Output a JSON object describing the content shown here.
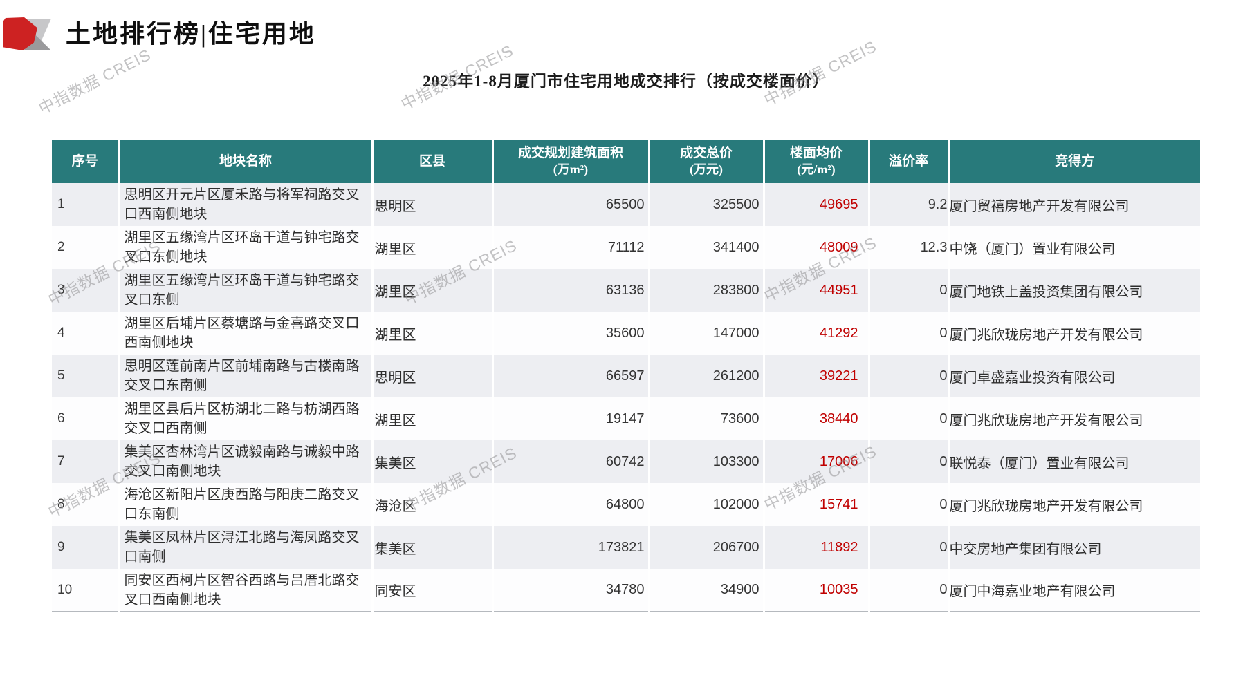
{
  "page": {
    "title": "土地排行榜|住宅用地",
    "subtitle": "2025年1-8月厦门市住宅用地成交排行（按成交楼面价）",
    "watermark": "中指数据 CREIS"
  },
  "colors": {
    "header_bg": "#287a7b",
    "accent_red": "#c00000",
    "row_alt_bg": "#edeef2",
    "logo_red": "#cd2222"
  },
  "table": {
    "columns": [
      {
        "label": "序号",
        "unit": ""
      },
      {
        "label": "地块名称",
        "unit": ""
      },
      {
        "label": "区县",
        "unit": ""
      },
      {
        "label": "成交规划建筑面积",
        "unit": "(万m²)"
      },
      {
        "label": "成交总价",
        "unit": "(万元)"
      },
      {
        "label": "楼面均价",
        "unit": "(元/m²)"
      },
      {
        "label": "溢价率",
        "unit": ""
      },
      {
        "label": "竞得方",
        "unit": ""
      }
    ],
    "rows": [
      {
        "seq": "1",
        "name": "思明区开元片区厦禾路与将军祠路交叉口西南侧地块",
        "district": "思明区",
        "area": "65500",
        "total_price": "325500",
        "floor_price": "49695",
        "premium": "9.2",
        "winner": "厦门贸禧房地产开发有限公司"
      },
      {
        "seq": "2",
        "name": "湖里区五缘湾片区环岛干道与钟宅路交叉口东侧地块",
        "district": "湖里区",
        "area": "71112",
        "total_price": "341400",
        "floor_price": "48009",
        "premium": "12.3",
        "winner": "中饶（厦门）置业有限公司"
      },
      {
        "seq": "3",
        "name": "湖里区五缘湾片区环岛干道与钟宅路交叉口东侧",
        "district": "湖里区",
        "area": "63136",
        "total_price": "283800",
        "floor_price": "44951",
        "premium": "0",
        "winner": "厦门地铁上盖投资集团有限公司"
      },
      {
        "seq": "4",
        "name": "湖里区后埔片区蔡塘路与金喜路交叉口西南侧地块",
        "district": "湖里区",
        "area": "35600",
        "total_price": "147000",
        "floor_price": "41292",
        "premium": "0",
        "winner": "厦门兆欣珑房地产开发有限公司"
      },
      {
        "seq": "5",
        "name": "思明区莲前南片区前埔南路与古楼南路交叉口东南侧",
        "district": "思明区",
        "area": "66597",
        "total_price": "261200",
        "floor_price": "39221",
        "premium": "0",
        "winner": "厦门卓盛嘉业投资有限公司"
      },
      {
        "seq": "6",
        "name": "湖里区县后片区枋湖北二路与枋湖西路交叉口西南侧",
        "district": "湖里区",
        "area": "19147",
        "total_price": "73600",
        "floor_price": "38440",
        "premium": "0",
        "winner": "厦门兆欣珑房地产开发有限公司"
      },
      {
        "seq": "7",
        "name": "集美区杏林湾片区诚毅南路与诚毅中路交叉口南侧地块",
        "district": "集美区",
        "area": "60742",
        "total_price": "103300",
        "floor_price": "17006",
        "premium": "0",
        "winner": "联悦泰（厦门）置业有限公司"
      },
      {
        "seq": "8",
        "name": "海沧区新阳片区庚西路与阳庚二路交叉口东南侧",
        "district": "海沧区",
        "area": "64800",
        "total_price": "102000",
        "floor_price": "15741",
        "premium": "0",
        "winner": "厦门兆欣珑房地产开发有限公司"
      },
      {
        "seq": "9",
        "name": "集美区凤林片区浔江北路与海凤路交叉口南侧",
        "district": "集美区",
        "area": "173821",
        "total_price": "206700",
        "floor_price": "11892",
        "premium": "0",
        "winner": "中交房地产集团有限公司"
      },
      {
        "seq": "10",
        "name": "同安区西柯片区智谷西路与吕厝北路交叉口西南侧地块",
        "district": "同安区",
        "area": "34780",
        "total_price": "34900",
        "floor_price": "10035",
        "premium": "0",
        "winner": "厦门中海嘉业地产有限公司"
      }
    ]
  }
}
